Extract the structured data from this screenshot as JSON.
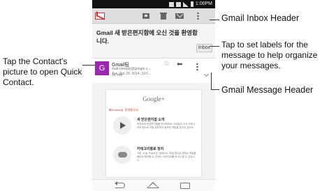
{
  "status_bar": {
    "time": "1:00PM"
  },
  "app_bar": {
    "logo_icon": "gmail-logo-icon",
    "icons": [
      "archive-icon",
      "delete-icon",
      "mail-icon",
      "overflow-menu-icon"
    ]
  },
  "message": {
    "subject": "Gmail 새 받은편지함에 오신 것을 환영합니다.",
    "label": "Inbox",
    "sender": {
      "avatar_letter": "G",
      "name": "Gmail팀",
      "email": "mail-noreply@google.c...",
      "date": "Tue, Apr 29, 2014, 10:0..."
    },
    "recipient": "To: me",
    "colors": {
      "avatar": "#9c27b0"
    }
  },
  "email_body": {
    "logo": "Google+",
    "tagline": "新Korean님, 환영합니다!",
    "sections": [
      {
        "title": "새 받은편지함 소개",
        "text": "편리하게 받은편지함을 관리하세요. 이메일이 주요 카테고리와 탭으로 자동 분류되어 중요한 메일을 놓치지 않아요."
      },
      {
        "title": "카테고리별로 정리",
        "text": "기본, 소셜, 프로모션, 업데이트, 포럼 탭으로 원하는 메일을 빠르게 확인할 수 있어요. 카테고리를 켜거나 끌 수 있습니다."
      }
    ]
  },
  "nav_bar": {
    "icons": [
      "back-icon",
      "home-icon",
      "recent-apps-icon"
    ]
  },
  "callouts": {
    "inbox_header": "Gmail Inbox Header",
    "labels": "Tap to set labels for the message to help organize your messages.",
    "message_header": "Gmail Message Header",
    "contact": "Tap the Contact's picture to open Quick Contact."
  }
}
